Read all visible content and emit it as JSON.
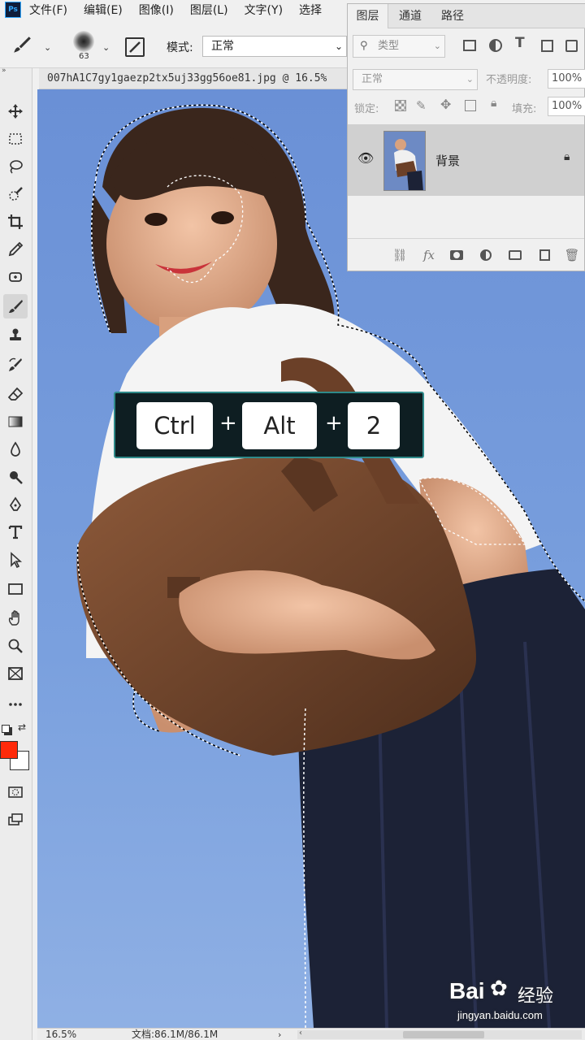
{
  "app": {
    "logo_text": "Ps"
  },
  "menu": [
    "文件(F)",
    "编辑(E)",
    "图像(I)",
    "图层(L)",
    "文字(Y)",
    "选择"
  ],
  "options": {
    "brush_size": "63",
    "mode_label": "模式:",
    "mode_value": "正常"
  },
  "document": {
    "tab_title": "007hA1C7gy1gaezp2tx5uj33gg56oe81.jpg @ 16.5%"
  },
  "shortcut": {
    "keys": [
      "Ctrl",
      "Alt",
      "2"
    ],
    "separator": "+"
  },
  "layers_panel": {
    "tabs": [
      "图层",
      "通道",
      "路径"
    ],
    "filter_placeholder": "类型",
    "blend_mode": "正常",
    "opacity_label": "不透明度:",
    "opacity_value": "100%",
    "lock_label": "锁定:",
    "fill_label": "填充:",
    "fill_value": "100%",
    "layer": {
      "name": "背景",
      "visible": true,
      "locked": true
    }
  },
  "colors": {
    "foreground": "#ff2a0a",
    "background": "#ffffff",
    "sky": "#6f97d8",
    "banner_border": "#2f8a8a"
  },
  "status": {
    "zoom": "16.5%",
    "doc_size": "文档:86.1M/86.1M"
  },
  "watermark": {
    "brand": "Bai",
    "brand_cn": "经验",
    "url": "jingyan.baidu.com"
  }
}
